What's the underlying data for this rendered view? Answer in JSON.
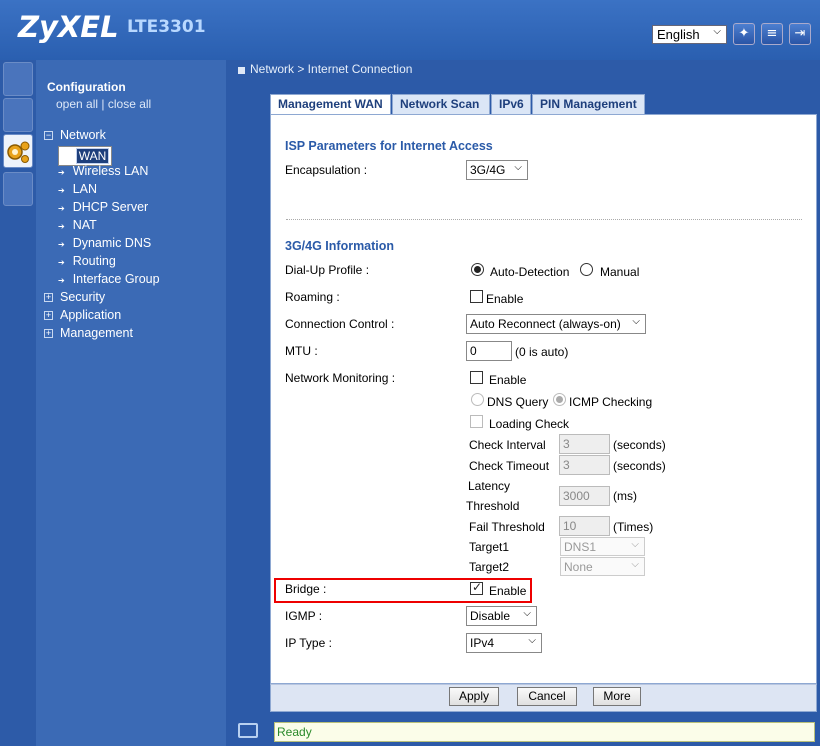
{
  "header": {
    "logo": "ZyXEL",
    "model": "LTE3301",
    "language": "English",
    "icons": [
      "wizard-icon",
      "notes-icon",
      "logout-icon"
    ]
  },
  "sidebar": {
    "title": "Configuration",
    "open_all": "open all",
    "sep": "|",
    "close_all": "close all",
    "network": "Network",
    "network_items": [
      "WAN",
      "Wireless LAN",
      "LAN",
      "DHCP Server",
      "NAT",
      "Dynamic DNS",
      "Routing",
      "Interface Group"
    ],
    "security": "Security",
    "application": "Application",
    "management": "Management"
  },
  "breadcrumb": "Network > Internet Connection",
  "tabs": [
    "Management WAN",
    "Network Scan",
    "IPv6",
    "PIN Management"
  ],
  "isp": {
    "title": "ISP Parameters for Internet Access",
    "encap_label": "Encapsulation :",
    "encap_value": "3G/4G"
  },
  "info": {
    "title": "3G/4G Information",
    "dialup_label": "Dial-Up Profile :",
    "auto": "Auto-Detection",
    "manual": "Manual",
    "roaming_label": "Roaming :",
    "enable": "Enable",
    "conn_label": "Connection Control :",
    "conn_value": "Auto Reconnect (always-on)",
    "mtu_label": "MTU :",
    "mtu_value": "0",
    "mtu_hint": "(0 is auto)",
    "netmon_label": "Network Monitoring :",
    "dns_query": "DNS Query",
    "icmp": "ICMP Checking",
    "loading": "Loading Check",
    "check_interval": "Check Interval",
    "check_interval_value": "3",
    "seconds": "(seconds)",
    "check_timeout": "Check Timeout",
    "check_timeout_value": "3",
    "latency1": "Latency",
    "latency2": "Threshold",
    "latency_value": "3000",
    "ms": "(ms)",
    "fail": "Fail Threshold",
    "fail_value": "10",
    "times": "(Times)",
    "target1": "Target1",
    "target1_value": "DNS1",
    "target2": "Target2",
    "target2_value": "None",
    "bridge_label": "Bridge :",
    "igmp_label": "IGMP :",
    "igmp_value": "Disable",
    "iptype_label": "IP Type :",
    "iptype_value": "IPv4"
  },
  "footer": {
    "apply": "Apply",
    "cancel": "Cancel",
    "more": "More"
  },
  "status": "Ready"
}
